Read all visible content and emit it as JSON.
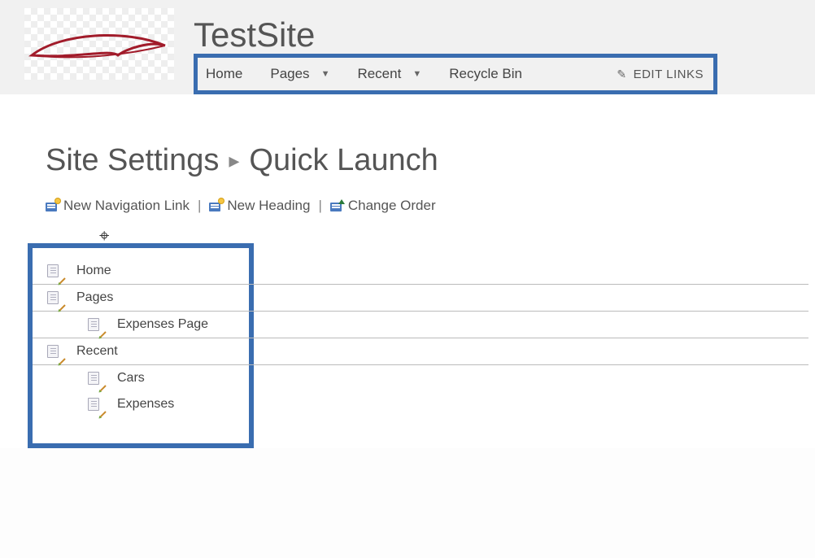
{
  "header": {
    "site_title": "TestSite",
    "nav": [
      {
        "label": "Home",
        "has_dropdown": false
      },
      {
        "label": "Pages",
        "has_dropdown": true
      },
      {
        "label": "Recent",
        "has_dropdown": true
      },
      {
        "label": "Recycle Bin",
        "has_dropdown": false
      }
    ],
    "edit_links_label": "EDIT LINKS"
  },
  "breadcrumb": {
    "parent": "Site Settings",
    "current": "Quick Launch"
  },
  "actions": {
    "new_link": "New Navigation Link",
    "new_heading": "New Heading",
    "change_order": "Change Order"
  },
  "nav_tree": {
    "items": [
      {
        "label": "Home",
        "children": []
      },
      {
        "label": "Pages",
        "children": [
          {
            "label": "Expenses Page"
          }
        ]
      },
      {
        "label": "Recent",
        "children": [
          {
            "label": "Cars"
          },
          {
            "label": "Expenses"
          }
        ]
      }
    ]
  }
}
